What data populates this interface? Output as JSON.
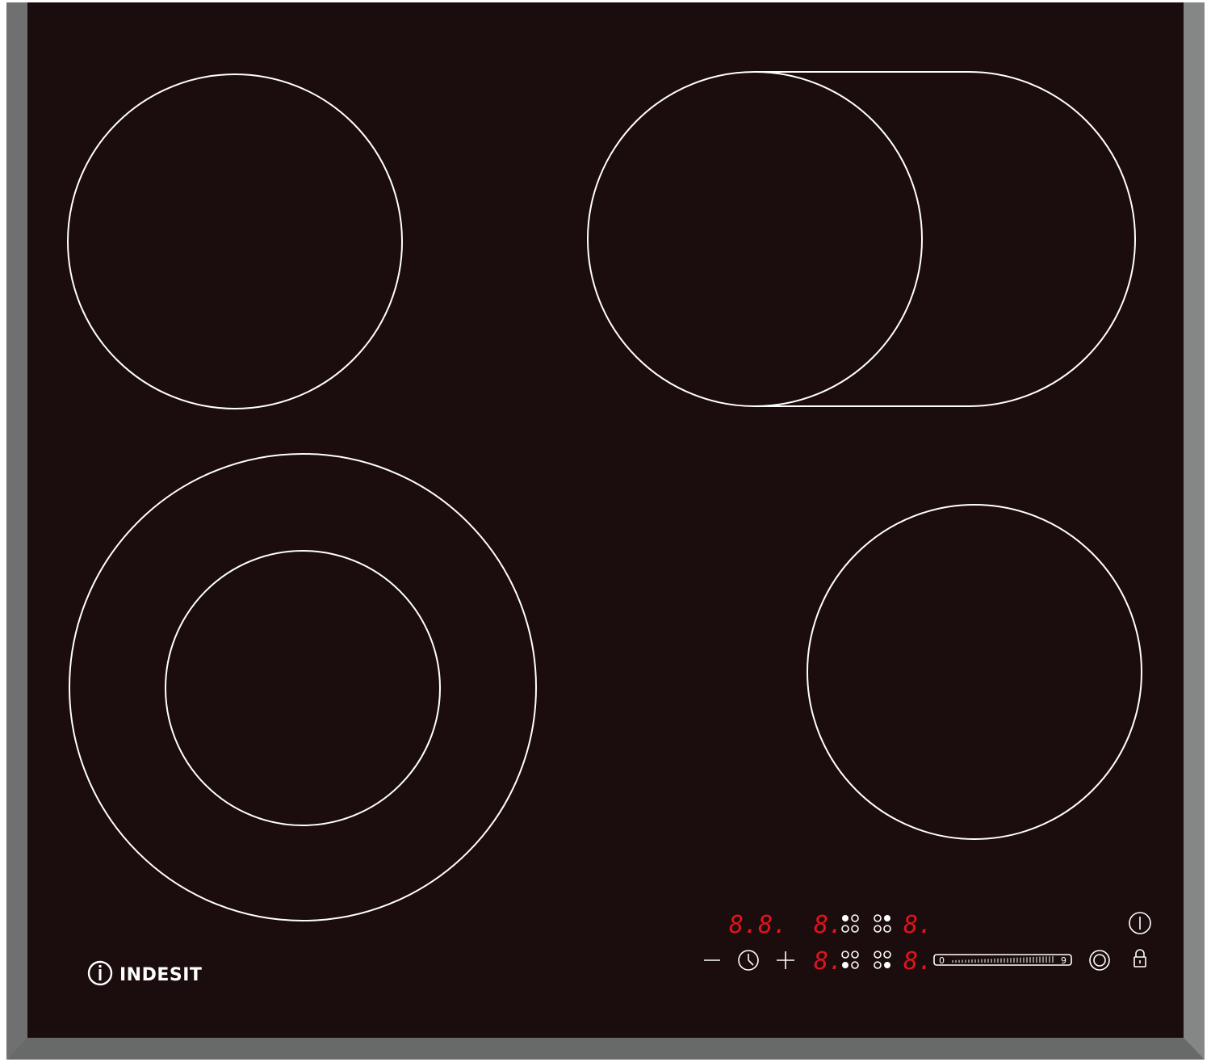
{
  "brand": {
    "name": "INDESIT",
    "logo_icon": "power-i-logo-icon"
  },
  "colors": {
    "glass": "#1b0c0d",
    "frame": "#7a7c7b",
    "zone_line": "#ffffff",
    "display_red": "#e0141e"
  },
  "displays": {
    "timer": "8.8.",
    "zone_top_left": "8.",
    "zone_top_right": "8.",
    "zone_bottom_left": "8.",
    "zone_bottom_right": "8."
  },
  "controls": {
    "minus": "—",
    "plus": "+",
    "clock_icon": "clock-icon",
    "power_icon": "power-icon",
    "dual_zone_icon": "dual-ring-icon",
    "lock_icon": "lock-icon"
  },
  "slider": {
    "min_label": "0",
    "max_label": "9"
  }
}
